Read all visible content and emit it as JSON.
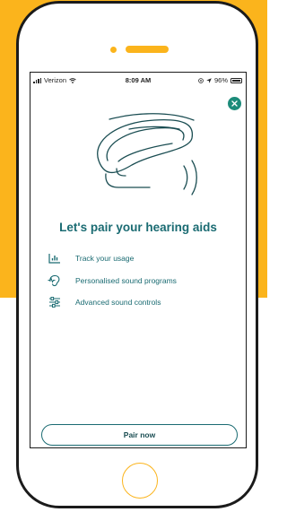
{
  "colors": {
    "accent": "#1c8b7a",
    "text": "#1a6b72",
    "brand_yellow": "#fbb41c"
  },
  "status_bar": {
    "carrier": "Verizon",
    "time": "8:09 AM",
    "battery": "96%"
  },
  "dialog": {
    "close_icon": "close-icon",
    "title": "Let's pair your hearing aids",
    "features": [
      {
        "icon": "bar-chart-icon",
        "label": "Track your usage"
      },
      {
        "icon": "sound-program-icon",
        "label": "Personalised sound programs"
      },
      {
        "icon": "sliders-icon",
        "label": "Advanced sound controls"
      }
    ],
    "pair_button_label": "Pair now"
  }
}
